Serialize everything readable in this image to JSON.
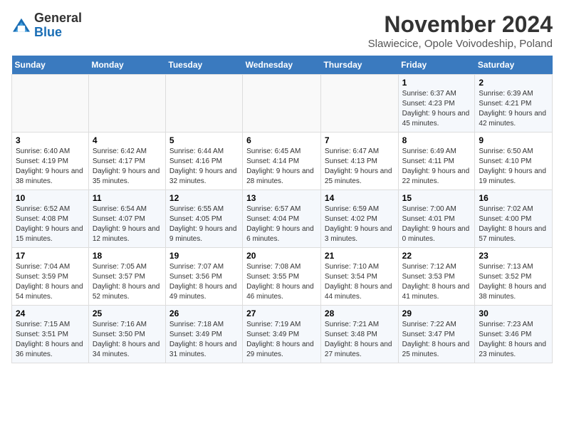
{
  "header": {
    "logo_line1": "General",
    "logo_line2": "Blue",
    "month": "November 2024",
    "location": "Slawiecice, Opole Voivodeship, Poland"
  },
  "weekdays": [
    "Sunday",
    "Monday",
    "Tuesday",
    "Wednesday",
    "Thursday",
    "Friday",
    "Saturday"
  ],
  "weeks": [
    [
      {
        "day": "",
        "info": ""
      },
      {
        "day": "",
        "info": ""
      },
      {
        "day": "",
        "info": ""
      },
      {
        "day": "",
        "info": ""
      },
      {
        "day": "",
        "info": ""
      },
      {
        "day": "1",
        "info": "Sunrise: 6:37 AM\nSunset: 4:23 PM\nDaylight: 9 hours and 45 minutes."
      },
      {
        "day": "2",
        "info": "Sunrise: 6:39 AM\nSunset: 4:21 PM\nDaylight: 9 hours and 42 minutes."
      }
    ],
    [
      {
        "day": "3",
        "info": "Sunrise: 6:40 AM\nSunset: 4:19 PM\nDaylight: 9 hours and 38 minutes."
      },
      {
        "day": "4",
        "info": "Sunrise: 6:42 AM\nSunset: 4:17 PM\nDaylight: 9 hours and 35 minutes."
      },
      {
        "day": "5",
        "info": "Sunrise: 6:44 AM\nSunset: 4:16 PM\nDaylight: 9 hours and 32 minutes."
      },
      {
        "day": "6",
        "info": "Sunrise: 6:45 AM\nSunset: 4:14 PM\nDaylight: 9 hours and 28 minutes."
      },
      {
        "day": "7",
        "info": "Sunrise: 6:47 AM\nSunset: 4:13 PM\nDaylight: 9 hours and 25 minutes."
      },
      {
        "day": "8",
        "info": "Sunrise: 6:49 AM\nSunset: 4:11 PM\nDaylight: 9 hours and 22 minutes."
      },
      {
        "day": "9",
        "info": "Sunrise: 6:50 AM\nSunset: 4:10 PM\nDaylight: 9 hours and 19 minutes."
      }
    ],
    [
      {
        "day": "10",
        "info": "Sunrise: 6:52 AM\nSunset: 4:08 PM\nDaylight: 9 hours and 15 minutes."
      },
      {
        "day": "11",
        "info": "Sunrise: 6:54 AM\nSunset: 4:07 PM\nDaylight: 9 hours and 12 minutes."
      },
      {
        "day": "12",
        "info": "Sunrise: 6:55 AM\nSunset: 4:05 PM\nDaylight: 9 hours and 9 minutes."
      },
      {
        "day": "13",
        "info": "Sunrise: 6:57 AM\nSunset: 4:04 PM\nDaylight: 9 hours and 6 minutes."
      },
      {
        "day": "14",
        "info": "Sunrise: 6:59 AM\nSunset: 4:02 PM\nDaylight: 9 hours and 3 minutes."
      },
      {
        "day": "15",
        "info": "Sunrise: 7:00 AM\nSunset: 4:01 PM\nDaylight: 9 hours and 0 minutes."
      },
      {
        "day": "16",
        "info": "Sunrise: 7:02 AM\nSunset: 4:00 PM\nDaylight: 8 hours and 57 minutes."
      }
    ],
    [
      {
        "day": "17",
        "info": "Sunrise: 7:04 AM\nSunset: 3:59 PM\nDaylight: 8 hours and 54 minutes."
      },
      {
        "day": "18",
        "info": "Sunrise: 7:05 AM\nSunset: 3:57 PM\nDaylight: 8 hours and 52 minutes."
      },
      {
        "day": "19",
        "info": "Sunrise: 7:07 AM\nSunset: 3:56 PM\nDaylight: 8 hours and 49 minutes."
      },
      {
        "day": "20",
        "info": "Sunrise: 7:08 AM\nSunset: 3:55 PM\nDaylight: 8 hours and 46 minutes."
      },
      {
        "day": "21",
        "info": "Sunrise: 7:10 AM\nSunset: 3:54 PM\nDaylight: 8 hours and 44 minutes."
      },
      {
        "day": "22",
        "info": "Sunrise: 7:12 AM\nSunset: 3:53 PM\nDaylight: 8 hours and 41 minutes."
      },
      {
        "day": "23",
        "info": "Sunrise: 7:13 AM\nSunset: 3:52 PM\nDaylight: 8 hours and 38 minutes."
      }
    ],
    [
      {
        "day": "24",
        "info": "Sunrise: 7:15 AM\nSunset: 3:51 PM\nDaylight: 8 hours and 36 minutes."
      },
      {
        "day": "25",
        "info": "Sunrise: 7:16 AM\nSunset: 3:50 PM\nDaylight: 8 hours and 34 minutes."
      },
      {
        "day": "26",
        "info": "Sunrise: 7:18 AM\nSunset: 3:49 PM\nDaylight: 8 hours and 31 minutes."
      },
      {
        "day": "27",
        "info": "Sunrise: 7:19 AM\nSunset: 3:49 PM\nDaylight: 8 hours and 29 minutes."
      },
      {
        "day": "28",
        "info": "Sunrise: 7:21 AM\nSunset: 3:48 PM\nDaylight: 8 hours and 27 minutes."
      },
      {
        "day": "29",
        "info": "Sunrise: 7:22 AM\nSunset: 3:47 PM\nDaylight: 8 hours and 25 minutes."
      },
      {
        "day": "30",
        "info": "Sunrise: 7:23 AM\nSunset: 3:46 PM\nDaylight: 8 hours and 23 minutes."
      }
    ]
  ]
}
